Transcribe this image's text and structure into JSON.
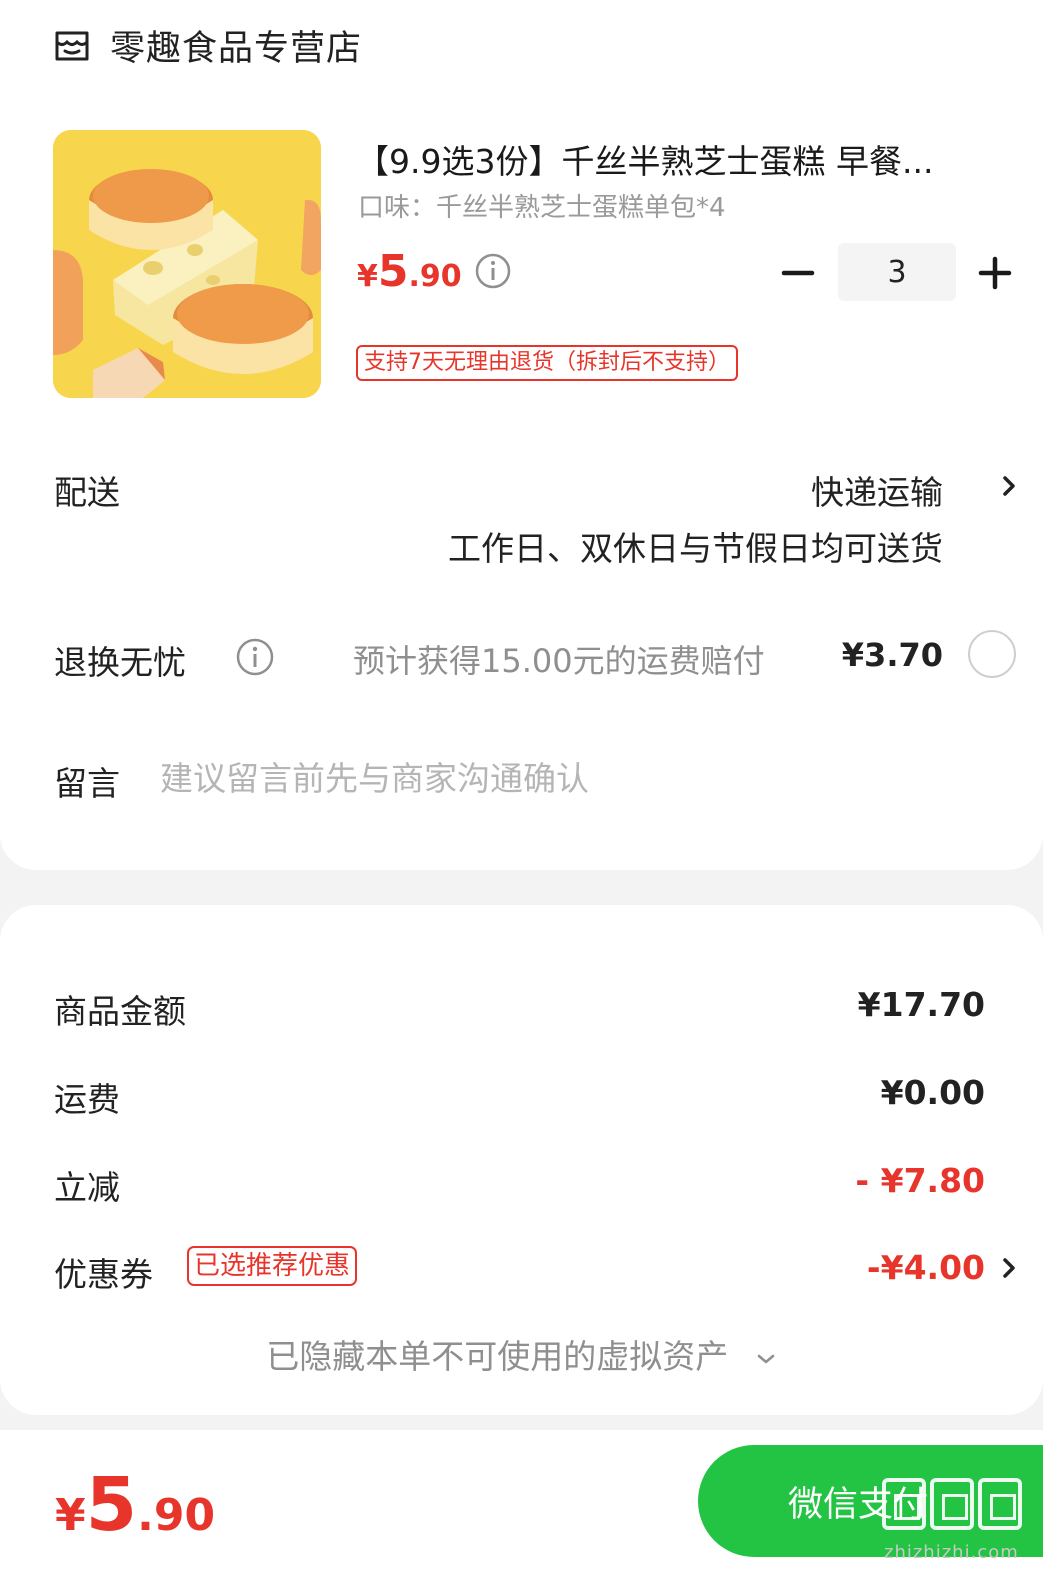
{
  "store": {
    "name": "零趣食品专营店",
    "icon": "store-icon"
  },
  "product": {
    "title": "【9.9选3份】千丝半熟芝士蛋糕 早餐...",
    "spec": "口味：千丝半熟芝士蛋糕单包*4",
    "price_currency": "¥",
    "price_int": "5",
    "price_dec": ".90",
    "quantity": "3",
    "return_policy": "支持7天无理由退货（拆封后不支持）"
  },
  "delivery": {
    "label": "配送",
    "method": "快递运输",
    "note": "工作日、双休日与节假日均可送货"
  },
  "return_worry": {
    "label": "退换无忧",
    "desc": "预计获得15.00元的运费赔付",
    "price": "¥3.70",
    "selected": false
  },
  "message": {
    "label": "留言",
    "placeholder": "建议留言前先与商家沟通确认",
    "value": ""
  },
  "summary": {
    "goods_label": "商品金额",
    "goods_value": "¥17.70",
    "shipping_label": "运费",
    "shipping_value": "¥0.00",
    "discount_label": "立减",
    "discount_value": "- ¥7.80",
    "coupon_label": "优惠券",
    "coupon_tag": "已选推荐优惠",
    "coupon_value": "-¥4.00",
    "hidden_assets": "已隐藏本单不可使用的虚拟资产"
  },
  "footer": {
    "total_currency": "¥",
    "total_int": "5",
    "total_dec": ".90",
    "pay_label": "微信支付",
    "watermark": "zhizhizhi.com"
  },
  "colors": {
    "accent_red": "#e8352b",
    "pay_green": "#23c343",
    "background": "#f3f3f3"
  }
}
